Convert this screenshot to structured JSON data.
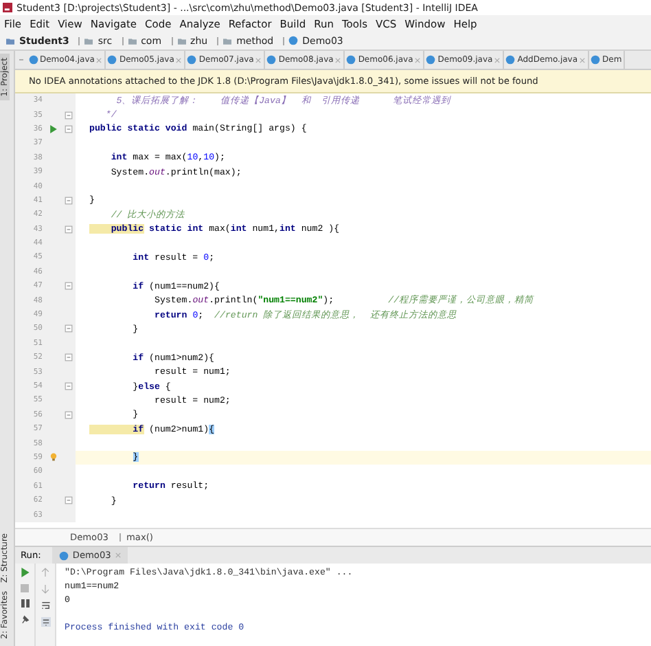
{
  "window": {
    "title": "Student3 [D:\\projects\\Student3] - ...\\src\\com\\zhu\\method\\Demo03.java [Student3] - IntelliJ IDEA"
  },
  "menu": [
    "File",
    "Edit",
    "View",
    "Navigate",
    "Code",
    "Analyze",
    "Refactor",
    "Build",
    "Run",
    "Tools",
    "VCS",
    "Window",
    "Help"
  ],
  "navigation": [
    {
      "label": "Student3",
      "kind": "project"
    },
    {
      "label": "src",
      "kind": "folder"
    },
    {
      "label": "com",
      "kind": "folder"
    },
    {
      "label": "zhu",
      "kind": "folder"
    },
    {
      "label": "method",
      "kind": "folder"
    },
    {
      "label": "Demo03",
      "kind": "class"
    }
  ],
  "side_tools": {
    "top": [
      {
        "label": "1: Project",
        "selected": true
      }
    ],
    "bottom": [
      {
        "label": "Z: Structure",
        "selected": false
      },
      {
        "label": "2: Favorites",
        "selected": false
      }
    ]
  },
  "tabs": [
    {
      "label": "Demo04.java"
    },
    {
      "label": "Demo05.java"
    },
    {
      "label": "Demo07.java"
    },
    {
      "label": "Demo08.java"
    },
    {
      "label": "Demo06.java"
    },
    {
      "label": "Demo09.java"
    },
    {
      "label": "AddDemo.java"
    },
    {
      "label": "Dem"
    }
  ],
  "banner": "No IDEA annotations attached to the JDK 1.8 (D:\\Program Files\\Java\\jdk1.8.0_341), some issues will not be found",
  "code_lines": [
    {
      "number": "34",
      "fold": false,
      "current": false,
      "tokens": [
        {
          "text": "     5、课后拓展了解：    值传递【Java】  和  引用传递      笔试经常遇到",
          "kind": "doc"
        }
      ]
    },
    {
      "number": "35",
      "fold": true,
      "current": false,
      "tokens": [
        {
          "text": "   */",
          "kind": "doc"
        }
      ]
    },
    {
      "number": "36",
      "fold": true,
      "current": false,
      "marker": {
        "kind": "run"
      },
      "tokens": [
        {
          "text": "public static void ",
          "kind": "kw"
        },
        {
          "text": "main(String[] args) {",
          "kind": "plain"
        }
      ]
    },
    {
      "number": "37",
      "fold": false,
      "current": false
    },
    {
      "number": "38",
      "fold": false,
      "current": false,
      "tokens": [
        {
          "text": "    int ",
          "kind": "kw"
        },
        {
          "text": "max = max(",
          "kind": "plain"
        },
        {
          "text": "10",
          "kind": "num"
        },
        {
          "text": ",",
          "kind": "plain"
        },
        {
          "text": "10",
          "kind": "num"
        },
        {
          "text": ");",
          "kind": "plain"
        }
      ]
    },
    {
      "number": "39",
      "fold": false,
      "current": false,
      "tokens": [
        {
          "text": "    System.",
          "kind": "plain"
        },
        {
          "text": "out",
          "kind": "field"
        },
        {
          "text": ".println(max);",
          "kind": "plain"
        }
      ]
    },
    {
      "number": "40",
      "fold": false,
      "current": false
    },
    {
      "number": "41",
      "fold": true,
      "current": false,
      "tokens": [
        {
          "text": "}",
          "kind": "plain"
        }
      ]
    },
    {
      "number": "42",
      "fold": false,
      "current": false,
      "tokens": [
        {
          "text": "    // 比大小的方法",
          "kind": "comment"
        }
      ]
    },
    {
      "number": "43",
      "fold": true,
      "current": false,
      "tokens": [
        {
          "text": "    public",
          "kind": "usage"
        },
        {
          "text": " static int ",
          "kind": "kw"
        },
        {
          "text": "max(",
          "kind": "plain"
        },
        {
          "text": "int ",
          "kind": "kw"
        },
        {
          "text": "num1,",
          "kind": "plain"
        },
        {
          "text": "int ",
          "kind": "kw"
        },
        {
          "text": "num2 ){",
          "kind": "plain"
        }
      ]
    },
    {
      "number": "44",
      "fold": false,
      "current": false
    },
    {
      "number": "45",
      "fold": false,
      "current": false,
      "tokens": [
        {
          "text": "        int ",
          "kind": "kw"
        },
        {
          "text": "result = ",
          "kind": "plain"
        },
        {
          "text": "0",
          "kind": "num"
        },
        {
          "text": ";",
          "kind": "plain"
        }
      ]
    },
    {
      "number": "46",
      "fold": false,
      "current": false
    },
    {
      "number": "47",
      "fold": true,
      "current": false,
      "tokens": [
        {
          "text": "        if ",
          "kind": "kw"
        },
        {
          "text": "(num1==num2){",
          "kind": "plain"
        }
      ]
    },
    {
      "number": "48",
      "fold": false,
      "current": false,
      "tokens": [
        {
          "text": "            System.",
          "kind": "plain"
        },
        {
          "text": "out",
          "kind": "field"
        },
        {
          "text": ".println(",
          "kind": "plain"
        },
        {
          "text": "\"num1==num2\"",
          "kind": "str"
        },
        {
          "text": ");          ",
          "kind": "plain"
        },
        {
          "text": "//程序需要严谨，公司意眼，精简",
          "kind": "comment"
        }
      ]
    },
    {
      "number": "49",
      "fold": false,
      "current": false,
      "tokens": [
        {
          "text": "            return ",
          "kind": "kw"
        },
        {
          "text": "0",
          "kind": "num"
        },
        {
          "text": ";  ",
          "kind": "plain"
        },
        {
          "text": "//return 除了返回结果的意思，  还有终止方法的意思",
          "kind": "comment"
        }
      ]
    },
    {
      "number": "50",
      "fold": true,
      "current": false,
      "tokens": [
        {
          "text": "        }",
          "kind": "plain"
        }
      ]
    },
    {
      "number": "51",
      "fold": false,
      "current": false
    },
    {
      "number": "52",
      "fold": true,
      "current": false,
      "tokens": [
        {
          "text": "        if ",
          "kind": "kw"
        },
        {
          "text": "(num1>num2){",
          "kind": "plain"
        }
      ]
    },
    {
      "number": "53",
      "fold": false,
      "current": false,
      "tokens": [
        {
          "text": "            result = num1;",
          "kind": "plain"
        }
      ]
    },
    {
      "number": "54",
      "fold": true,
      "current": false,
      "tokens": [
        {
          "text": "        }",
          "kind": "plain"
        },
        {
          "text": "else ",
          "kind": "kw"
        },
        {
          "text": "{",
          "kind": "plain"
        }
      ]
    },
    {
      "number": "55",
      "fold": false,
      "current": false,
      "tokens": [
        {
          "text": "            result = num2;",
          "kind": "plain"
        }
      ]
    },
    {
      "number": "56",
      "fold": true,
      "current": false,
      "tokens": [
        {
          "text": "        }",
          "kind": "plain"
        }
      ]
    },
    {
      "number": "57",
      "fold": false,
      "current": false,
      "tokens": [
        {
          "text": "        if",
          "kind": "usage"
        },
        {
          "text": " (num2>num1)",
          "kind": "plain"
        },
        {
          "text": "{",
          "kind": "brace"
        }
      ]
    },
    {
      "number": "58",
      "fold": false,
      "current": false
    },
    {
      "number": "59",
      "fold": false,
      "current": true,
      "marker": {
        "kind": "bulb"
      },
      "tokens": [
        {
          "text": "        }",
          "kind": "brace"
        }
      ]
    },
    {
      "number": "60",
      "fold": false,
      "current": false
    },
    {
      "number": "61",
      "fold": false,
      "current": false,
      "tokens": [
        {
          "text": "        return ",
          "kind": "kw"
        },
        {
          "text": "result;",
          "kind": "plain"
        }
      ]
    },
    {
      "number": "62",
      "fold": true,
      "current": false,
      "tokens": [
        {
          "text": "    }",
          "kind": "plain"
        }
      ]
    },
    {
      "number": "63",
      "fold": false,
      "current": false
    }
  ],
  "editor_breadcrumb": [
    "Demo03",
    "max()"
  ],
  "run_panel": {
    "label": "Run:",
    "tab": "Demo03",
    "output": [
      {
        "text": "\"D:\\Program Files\\Java\\jdk1.8.0_341\\bin\\java.exe\" ...",
        "kind": "command"
      },
      {
        "text": "num1==num2",
        "kind": "stdout"
      },
      {
        "text": "0",
        "kind": "stdout"
      },
      {
        "text": "Process finished with exit code 0",
        "kind": "exit"
      }
    ]
  }
}
